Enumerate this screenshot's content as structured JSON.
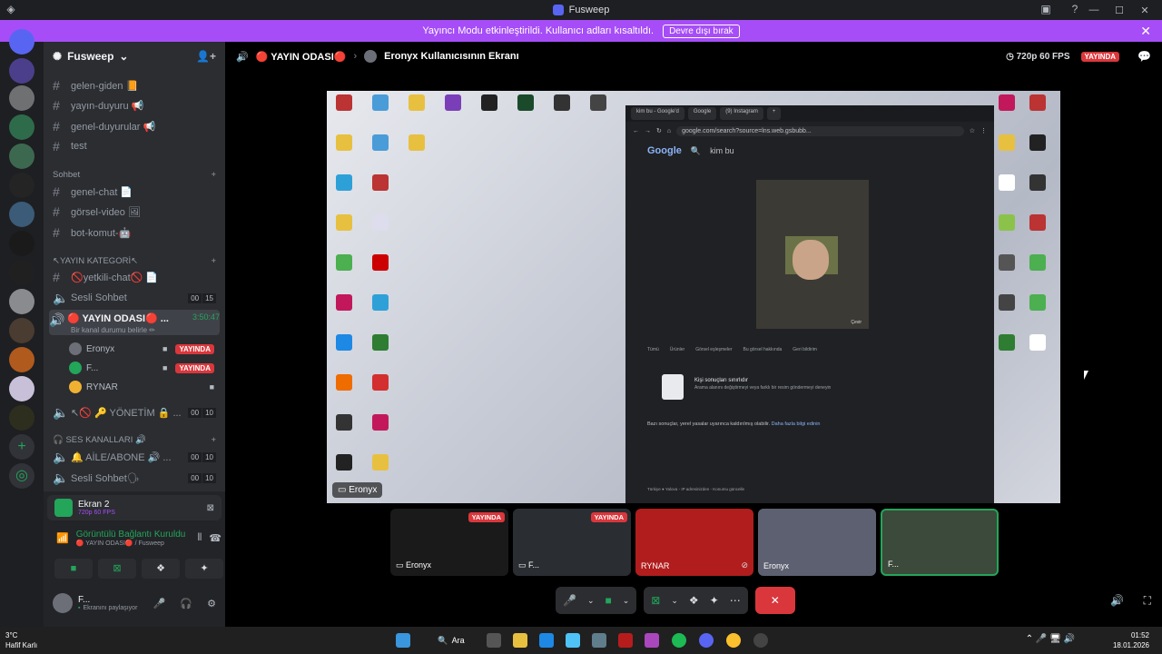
{
  "window": {
    "title": "Fusweep"
  },
  "banner": {
    "text": "Yayıncı Modu etkinleştirildi. Kullanıcı adları kısaltıldı.",
    "button": "Devre dışı bırak"
  },
  "server": {
    "name": "Fusweep"
  },
  "channels": {
    "text1": [
      "gelen-giden 📙",
      "yayın-duyuru 📢",
      "genel-duyurular 📢",
      "test"
    ],
    "cat_sohbet": "Sohbet",
    "text2": [
      "genel-chat 📄",
      "görsel-video 🖼",
      "bot-komut-🤖"
    ],
    "cat_yayin": "↖YAYIN KATEGORİ↖",
    "yetkili": "🚫yetkili-chat🚫 📄",
    "sesli": "Sesli Sohbet",
    "sesli_c1": "00",
    "sesli_c2": "15",
    "yayin_odasi": "🔴 YAYIN ODASI🔴 ...",
    "yayin_timer": "3:50:47",
    "yayin_status": "Bir kanal durumu belirle ✏",
    "users": [
      {
        "name": "Eronyx",
        "live": "YAYINDA"
      },
      {
        "name": "F...",
        "live": "YAYINDA"
      },
      {
        "name": "RYNAR",
        "live": ""
      }
    ],
    "yonetim": "↖🚫 🔑 YÖNETİM 🔒 ...",
    "yonetim_c1": "00",
    "yonetim_c2": "10",
    "cat_ses": "🎧 SES KANALLARI 🔊",
    "aile": "🔔 AİLE/ABONE 🔊 ...",
    "aile_c1": "00",
    "aile_c2": "10",
    "sesli2": "Sesli Sohbet🗣",
    "sesli2_c1": "00",
    "sesli2_c2": "10"
  },
  "panel": {
    "screen_title": "Ekran 2",
    "screen_sub": "720p 60 FPS",
    "conn": "Görüntülü Bağlantı Kuruldu",
    "conn_sub": "🔴 YAYIN ODASI🔴 / Fusweep",
    "user": "F...",
    "user_status": "Ekranını paylaşıyor"
  },
  "header": {
    "channel": "🔴 YAYIN ODASI🔴",
    "screen_of": "Eronyx Kullanıcısının Ekranı",
    "quality": "720p 60 FPS",
    "live": "YAYINDA"
  },
  "stream": {
    "tag": "Eronyx",
    "browser": {
      "tabs": [
        "kim bu - Google'd",
        "Google",
        "(9) Instagram"
      ],
      "url": "google.com/search?source=lns.web.gsbubb...",
      "logo": "Google",
      "query": "kim bu",
      "translate": "Çevir",
      "result_tabs": [
        "Tümü",
        "Ürünler",
        "Görsel eşleşmeler",
        "Bu görsel hakkında",
        "Geri bildirim"
      ],
      "no_results": "Kişi sonuçları sınırlıdır",
      "no_results_sub": "Arama alanını değiştirmeyi veya farklı bir resim göndermeyi deneyin",
      "legal": "Bazı sonuçlar, yerel yasalar uyarınca kaldırılmış olabilir.",
      "legal_link": "Daha fazla bilgi edinin",
      "footer": "Türkiye   ● Yalova - IP adresinizden - Konumu güncelle"
    }
  },
  "thumbs": [
    {
      "name": "Eronyx",
      "live": "YAYINDA",
      "bg": "#1a1a1a"
    },
    {
      "name": "F...",
      "live": "YAYINDA",
      "bg": "#2a2d32"
    },
    {
      "name": "RYNAR",
      "live": "",
      "bg": "#b11d1d"
    },
    {
      "name": "Eronyx",
      "live": "",
      "bg": "#5d6070"
    },
    {
      "name": "F...",
      "live": "",
      "bg": "#3b4a3a"
    }
  ],
  "taskbar": {
    "weather_temp": "3°C",
    "weather_text": "Hafif Karlı",
    "search": "Ara",
    "time": "01:52",
    "date": "18.01.2026"
  },
  "colors": {
    "accent": "#5865f2",
    "live": "#da373c",
    "banner": "#a64df7",
    "green": "#23a55a"
  }
}
